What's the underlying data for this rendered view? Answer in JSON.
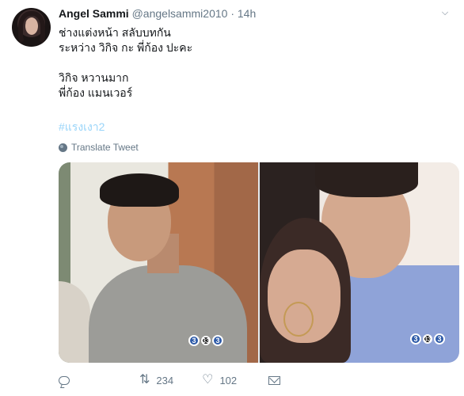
{
  "tweet": {
    "author": {
      "name": "Angel Sammi",
      "handle": "@angelsammi2010",
      "separator": "·",
      "time": "14h"
    },
    "lines": [
      "ช่างแต่งหน้า สลับบทกัน",
      "ระหว่าง วิกิจ กะ พี่ก้อง ปะคะ",
      "",
      "วิกิจ หวานมาก",
      "พี่ก้อง แมนเวอร์"
    ],
    "hashtag": "#แรงเงา2",
    "translate_label": "Translate Tweet",
    "media": {
      "logo_digits": [
        "3",
        "33",
        "3"
      ]
    },
    "actions": {
      "reply_count": "",
      "retweet_count": "234",
      "like_count": "102"
    }
  },
  "colors": {
    "text": "#14171a",
    "muted": "#657786",
    "link": "#1da1f2"
  },
  "icons": [
    "avatar",
    "chevron-down-icon",
    "globe-icon",
    "reply-icon",
    "retweet-icon",
    "heart-icon",
    "direct-message-icon",
    "channel3-logo"
  ]
}
